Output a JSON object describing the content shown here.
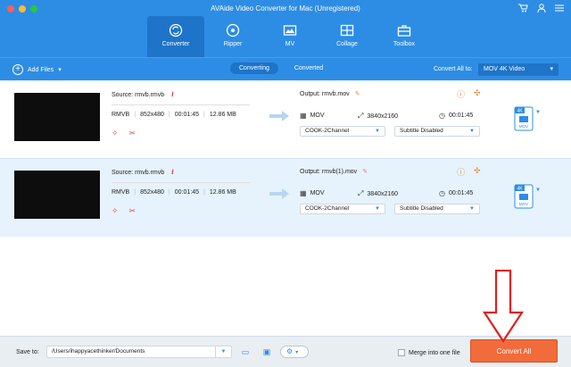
{
  "window": {
    "title": "AVAide Video Converter for Mac (Unregistered)"
  },
  "header_icons": [
    "cart-icon",
    "user-icon",
    "menu-icon"
  ],
  "nav": [
    {
      "label": "Converter",
      "icon": "converter-icon",
      "active": true
    },
    {
      "label": "Ripper",
      "icon": "ripper-icon",
      "active": false
    },
    {
      "label": "MV",
      "icon": "mv-icon",
      "active": false
    },
    {
      "label": "Collage",
      "icon": "collage-icon",
      "active": false
    },
    {
      "label": "Toolbox",
      "icon": "toolbox-icon",
      "active": false
    }
  ],
  "toolbar": {
    "add_files": "Add Files",
    "tabs": [
      "Converting",
      "Converted"
    ],
    "convert_all_label": "Convert All to:",
    "convert_all_value": "MOV 4K Video"
  },
  "files": [
    {
      "source": "Source: rmvb.rmvb",
      "format": "RMVB",
      "resolution": "852x480",
      "duration": "00:01:45",
      "size": "12.86 MB",
      "output": "Output: rmvb.mov",
      "out_format": "MOV",
      "out_resolution": "3840x2160",
      "out_duration": "00:01:45",
      "audio": "COOK-2Channel",
      "subtitle": "Subtitle Disabled",
      "badge_top": "4K",
      "badge_bottom": "MOV"
    },
    {
      "source": "Source: rmvb.rmvb",
      "format": "RMVB",
      "resolution": "852x480",
      "duration": "00:01:45",
      "size": "12.86 MB",
      "output": "Output: rmvb(1).mov",
      "out_format": "MOV",
      "out_resolution": "3840x2160",
      "out_duration": "00:01:45",
      "audio": "COOK-2Channel",
      "subtitle": "Subtitle Disabled",
      "badge_top": "4K",
      "badge_bottom": "MOV"
    }
  ],
  "footer": {
    "save_to_label": "Save to:",
    "save_path": "/Users/ihappyacethinker/Documents",
    "merge_label": "Merge into one file",
    "convert_button": "Convert All"
  },
  "colors": {
    "brand": "#2d8de4",
    "accent": "#f26b3a",
    "annotation": "#e02020"
  }
}
